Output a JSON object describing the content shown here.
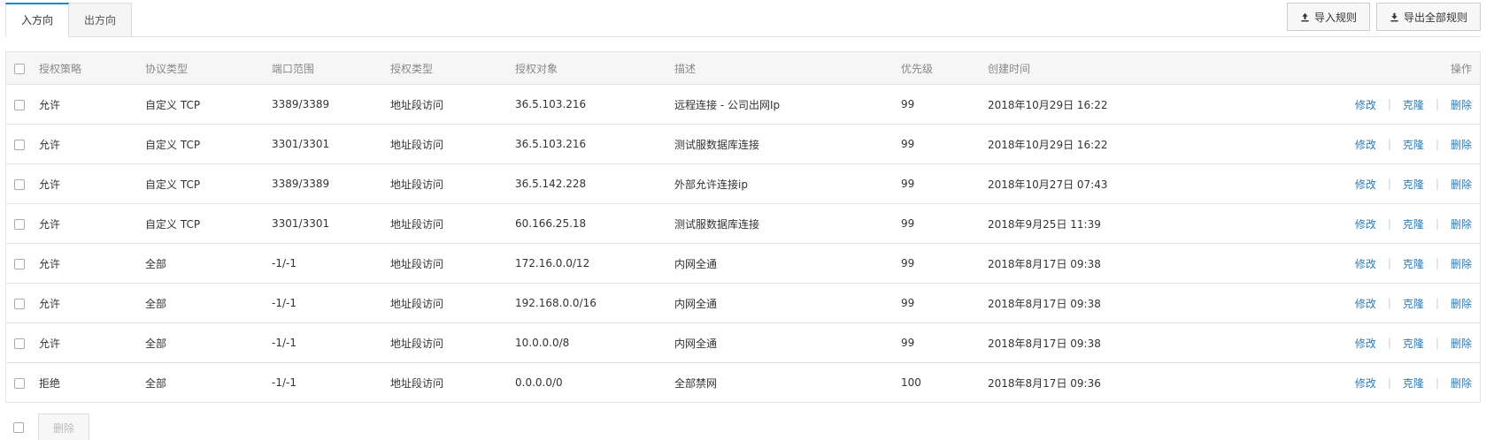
{
  "tabs": [
    {
      "label": "入方向",
      "active": true
    },
    {
      "label": "出方向",
      "active": false
    }
  ],
  "toolbar": {
    "import_label": "导入规则",
    "export_label": "导出全部规则"
  },
  "table": {
    "headers": {
      "policy": "授权策略",
      "protocol": "协议类型",
      "port": "端口范围",
      "auth_type": "授权类型",
      "auth_object": "授权对象",
      "description": "描述",
      "priority": "优先级",
      "created": "创建时间",
      "ops": "操作"
    },
    "actions": {
      "edit": "修改",
      "clone": "克隆",
      "delete": "删除"
    },
    "rows": [
      {
        "policy": "允许",
        "protocol": "自定义 TCP",
        "port": "3389/3389",
        "auth_type": "地址段访问",
        "auth_object": "36.5.103.216",
        "description": "远程连接 - 公司出网Ip",
        "priority": "99",
        "created": "2018年10月29日 16:22"
      },
      {
        "policy": "允许",
        "protocol": "自定义 TCP",
        "port": "3301/3301",
        "auth_type": "地址段访问",
        "auth_object": "36.5.103.216",
        "description": "测试服数据库连接",
        "priority": "99",
        "created": "2018年10月29日 16:22"
      },
      {
        "policy": "允许",
        "protocol": "自定义 TCP",
        "port": "3389/3389",
        "auth_type": "地址段访问",
        "auth_object": "36.5.142.228",
        "description": "外部允许连接ip",
        "priority": "99",
        "created": "2018年10月27日 07:43"
      },
      {
        "policy": "允许",
        "protocol": "自定义 TCP",
        "port": "3301/3301",
        "auth_type": "地址段访问",
        "auth_object": "60.166.25.18",
        "description": "测试服数据库连接",
        "priority": "99",
        "created": "2018年9月25日 11:39"
      },
      {
        "policy": "允许",
        "protocol": "全部",
        "port": "-1/-1",
        "auth_type": "地址段访问",
        "auth_object": "172.16.0.0/12",
        "description": "内网全通",
        "priority": "99",
        "created": "2018年8月17日 09:38"
      },
      {
        "policy": "允许",
        "protocol": "全部",
        "port": "-1/-1",
        "auth_type": "地址段访问",
        "auth_object": "192.168.0.0/16",
        "description": "内网全通",
        "priority": "99",
        "created": "2018年8月17日 09:38"
      },
      {
        "policy": "允许",
        "protocol": "全部",
        "port": "-1/-1",
        "auth_type": "地址段访问",
        "auth_object": "10.0.0.0/8",
        "description": "内网全通",
        "priority": "99",
        "created": "2018年8月17日 09:38"
      },
      {
        "policy": "拒绝",
        "protocol": "全部",
        "port": "-1/-1",
        "auth_type": "地址段访问",
        "auth_object": "0.0.0.0/0",
        "description": "全部禁网",
        "priority": "100",
        "created": "2018年8月17日 09:36"
      }
    ]
  },
  "footer": {
    "delete_label": "删除"
  },
  "colors": {
    "accent": "#0088cc",
    "link": "#2e7bb5"
  },
  "icons": {
    "import": "upload-icon",
    "export": "download-icon"
  }
}
